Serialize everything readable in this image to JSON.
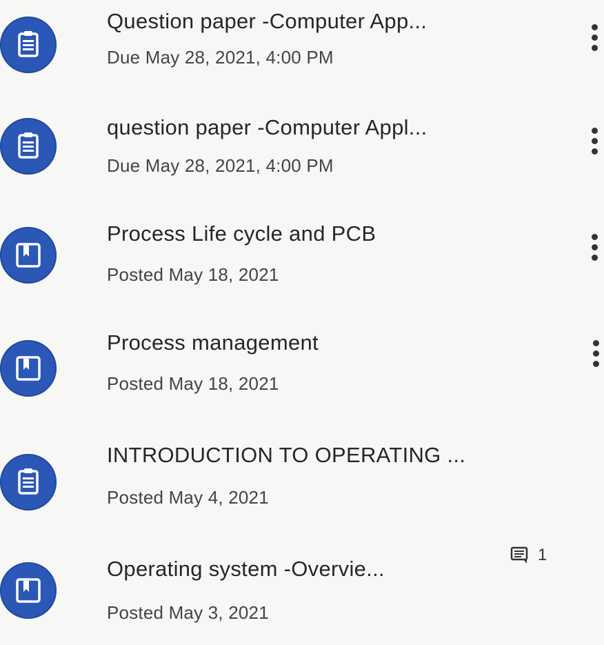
{
  "stream": {
    "items": [
      {
        "type": "assignment",
        "icon": "assignment-icon",
        "title": "Question paper -Computer App...",
        "meta": "Due May 28, 2021, 4:00 PM"
      },
      {
        "type": "assignment",
        "icon": "assignment-icon",
        "title": "question paper -Computer Appl...",
        "meta": "Due May 28, 2021, 4:00 PM"
      },
      {
        "type": "material",
        "icon": "material-icon",
        "title": "Process Life cycle and PCB",
        "meta": "Posted May 18, 2021"
      },
      {
        "type": "material",
        "icon": "material-icon",
        "title": "Process management",
        "meta": "Posted May 18, 2021"
      },
      {
        "type": "assignment",
        "icon": "assignment-icon",
        "title": "INTRODUCTION TO OPERATING ...",
        "meta": "Posted May 4, 2021"
      },
      {
        "type": "material",
        "icon": "material-icon",
        "title": "Operating system -Overvie...",
        "meta": "Posted May 3, 2021",
        "comment_count": "1"
      }
    ]
  },
  "colors": {
    "icon_circle": "#2b57b6",
    "icon_glyph": "#ffffff",
    "title_text": "#262626",
    "meta_text": "#444444",
    "background": "#f7f7f5"
  }
}
